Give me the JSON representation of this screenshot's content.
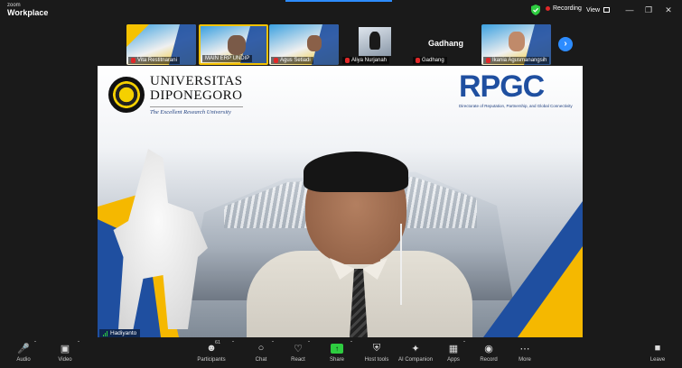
{
  "app": {
    "logo_top": "zoom",
    "logo_bottom": "Workplace",
    "recording_label": "Recording",
    "view_label": "View"
  },
  "thumbnails": [
    {
      "name": "Vita Restitnarani",
      "muted": true,
      "style": "slide"
    },
    {
      "name": "MAIN ERP UNDIP",
      "muted": false,
      "style": "slide-active"
    },
    {
      "name": "Agus Setiadi",
      "muted": true,
      "style": "slide"
    },
    {
      "name": "Aliya Nurjanah",
      "muted": true,
      "style": "photo"
    },
    {
      "name": "Gadhang",
      "muted": true,
      "style": "dark",
      "big_label": "Gadhang"
    },
    {
      "name": "Ikania Agusmanangsih",
      "muted": true,
      "style": "slide"
    }
  ],
  "main": {
    "university_line1": "UNIVERSITAS",
    "university_line2": "DIPONEGORO",
    "university_tagline": "The Excellent Research University",
    "rpgc_logo": "RPGC",
    "rpgc_subtitle": "Directorate of Reputation, Partnership, and Global Connectivity",
    "speaker_name": "Hadiyanto"
  },
  "toolbar": {
    "audio": "Audio",
    "video": "Video",
    "participants": "Participants",
    "participants_count": "61",
    "chat": "Chat",
    "react": "React",
    "share": "Share",
    "host_tools": "Host tools",
    "ai_companion": "AI Companion",
    "apps": "Apps",
    "record": "Record",
    "more": "More",
    "leave": "Leave"
  },
  "colors": {
    "accent_blue": "#2d8cff",
    "recording_red": "#e02828",
    "share_green": "#2ecc40",
    "brand_yellow": "#f5b800",
    "brand_navy": "#1f4fa0"
  }
}
